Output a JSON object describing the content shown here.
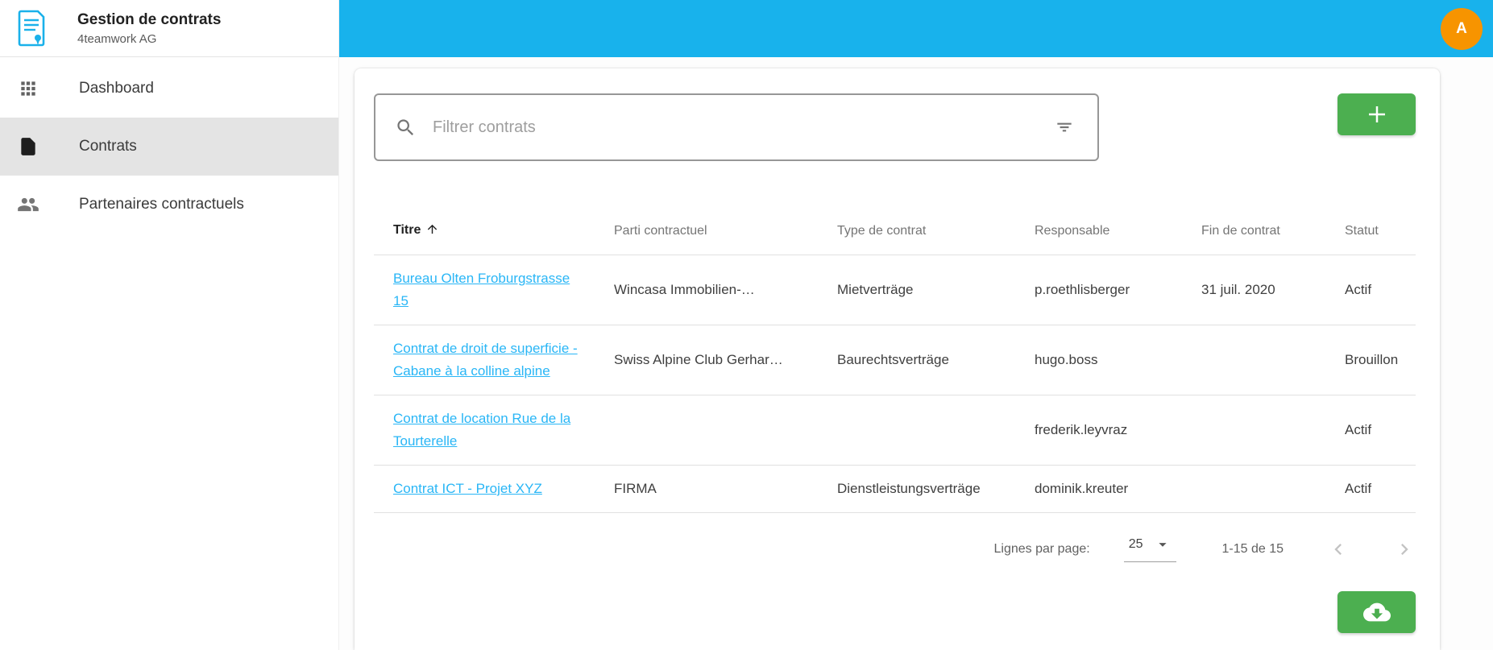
{
  "app": {
    "title": "Gestion de contrats",
    "subtitle": "4teamwork AG"
  },
  "sidebar": {
    "items": [
      {
        "label": "Dashboard",
        "icon": "grid-icon"
      },
      {
        "label": "Contrats",
        "icon": "document-icon"
      },
      {
        "label": "Partenaires contractuels",
        "icon": "people-icon"
      }
    ],
    "active_item": "Contrats"
  },
  "topbar": {
    "avatar_letter": "A"
  },
  "search": {
    "placeholder": "Filtrer contrats",
    "value": ""
  },
  "table": {
    "columns": {
      "title": "Titre",
      "party": "Parti contractuel",
      "type": "Type de contrat",
      "responsible": "Responsable",
      "end": "Fin de contrat",
      "status": "Statut"
    },
    "sort": {
      "column": "Titre",
      "direction": "asc"
    },
    "rows": [
      {
        "title": "Bureau Olten Froburgstrasse 15",
        "party": "Wincasa Immobilien-…",
        "type": "Mietverträge",
        "responsible": "p.roethlisberger",
        "end": "31 juil. 2020",
        "status": "Actif"
      },
      {
        "title": "Contrat de droit de superficie - Cabane à la colline alpine",
        "party": "Swiss Alpine Club Gerhar…",
        "type": "Baurechtsverträge",
        "responsible": "hugo.boss",
        "end": "",
        "status": "Brouillon"
      },
      {
        "title": "Contrat de location Rue de la Tourterelle",
        "party": "",
        "type": "",
        "responsible": "frederik.leyvraz",
        "end": "",
        "status": "Actif"
      },
      {
        "title": "Contrat ICT - Projet XYZ",
        "party": "FIRMA",
        "type": "Dienstleistungsverträge",
        "responsible": "dominik.kreuter",
        "end": "",
        "status": "Actif"
      }
    ]
  },
  "pagination": {
    "rows_per_page_label": "Lignes par page:",
    "rows_per_page_value": "25",
    "range_label": "1-15 de 15"
  },
  "colors": {
    "topbar": "#18b2ec",
    "avatar": "#f79400",
    "accent_green": "#4caf50",
    "link_blue": "#29b6f6",
    "active_item_bg": "#e4e4e4",
    "logo_cyan": "#1ab1ea"
  }
}
